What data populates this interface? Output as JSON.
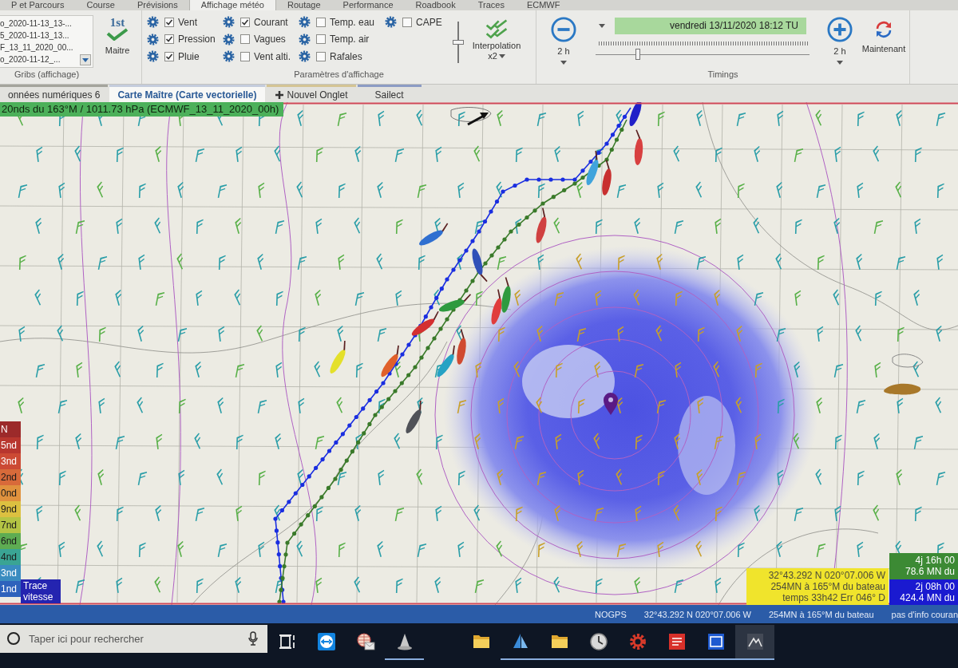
{
  "menu_tabs": [
    {
      "label": "P et Parcours",
      "selected": false
    },
    {
      "label": "Course",
      "selected": false
    },
    {
      "label": "Prévisions",
      "selected": false
    },
    {
      "label": "Affichage météo",
      "selected": true
    },
    {
      "label": "Routage",
      "selected": false
    },
    {
      "label": "Performance",
      "selected": false
    },
    {
      "label": "Roadbook",
      "selected": false
    },
    {
      "label": "Traces",
      "selected": false
    },
    {
      "label": "ECMWF",
      "selected": false
    }
  ],
  "ribbon": {
    "gribs": {
      "files": [
        "o_2020-11-13_13-...",
        "5_2020-11-13_13...",
        "F_13_11_2020_00...",
        "o_2020-11-12_..."
      ],
      "master": {
        "rank": "1st",
        "label": "Maitre"
      },
      "group_label": "Gribs (affichage)"
    },
    "display": {
      "layers": [
        {
          "label": "Vent",
          "checked": true
        },
        {
          "label": "Pression",
          "checked": true
        },
        {
          "label": "Pluie",
          "checked": true
        },
        {
          "label": "Courant",
          "checked": true
        },
        {
          "label": "Vagues",
          "checked": false
        },
        {
          "label": "Vent alti.",
          "checked": false
        },
        {
          "label": "Temp. eau",
          "checked": false
        },
        {
          "label": "Temp. air",
          "checked": false
        },
        {
          "label": "Rafales",
          "checked": false
        },
        {
          "label": "CAPE",
          "checked": false
        }
      ],
      "slider": {
        "level": 0.5
      },
      "interpolation": {
        "label": "Interpolation",
        "factor": "x2"
      },
      "group_label": "Paramètres d'affichage"
    },
    "timings": {
      "step_back": "2 h",
      "date": "vendredi 13/11/2020 18:12 TU",
      "slider": {
        "level": 0.19
      },
      "step_forward": "2 h",
      "now": "Maintenant",
      "group_label": "Timings"
    }
  },
  "doc_tabs": [
    {
      "kind": "tab",
      "label": "onnées numériques 6",
      "selected": false,
      "color": "#a4a49c"
    },
    {
      "kind": "tab",
      "label": "Carte Maître (Carte vectorielle)",
      "selected": true,
      "color": "#c4ccdc"
    },
    {
      "kind": "new",
      "label": "Nouvel Onglet",
      "selected": false,
      "color": "#d4c494"
    },
    {
      "kind": "tab",
      "label": "Sailect",
      "selected": false,
      "color": "#8c9cc4"
    }
  ],
  "map": {
    "readout": "20nds du 163°M / 1011.73 hPa (ECMWF_13_11_2020_00h)",
    "legend": [
      {
        "label": "N",
        "color": "#9c2a2a"
      },
      {
        "label": "5nd",
        "color": "#b8362e"
      },
      {
        "label": "3nd",
        "color": "#cc4a34"
      },
      {
        "label": "2nd",
        "color": "#d86a3a"
      },
      {
        "label": "0nd",
        "color": "#e0923e"
      },
      {
        "label": "9nd",
        "color": "#dcc040"
      },
      {
        "label": "7nd",
        "color": "#b4c444"
      },
      {
        "label": "6nd",
        "color": "#5eac52"
      },
      {
        "label": "4nd",
        "color": "#3aa494"
      },
      {
        "label": "3nd",
        "color": "#3a8cc0"
      },
      {
        "label": "1nd",
        "color": "#2e62bc"
      }
    ],
    "trace_label": "Trace vitesse",
    "cursor_info": [
      "32°43.292 N 020°07.006 W",
      "254MN à 165°M du bateau",
      "temps 33h42 Err 046° D"
    ],
    "eta": [
      {
        "lines": [
          "4j 16h 00",
          "78.6 MN du"
        ],
        "color": "#3c8a34"
      },
      {
        "lines": [
          "2j 08h 00",
          "424.4 MN du"
        ],
        "color": "#1a1ad0"
      }
    ]
  },
  "status_bar": [
    "NOGPS",
    "32°43.292 N 020°07.006 W",
    "254MN à 165°M du bateau",
    "pas d'info couran"
  ],
  "taskbar": {
    "search": {
      "placeholder": "Taper ici pour rechercher"
    },
    "apps": [
      {
        "kind": "task-view",
        "running": false,
        "selected": false
      },
      {
        "kind": "remote",
        "running": false,
        "selected": false
      },
      {
        "kind": "globe-mail",
        "running": false,
        "selected": false
      },
      {
        "kind": "cone",
        "running": true,
        "selected": false
      },
      {
        "kind": "folder",
        "running": false,
        "selected": false
      },
      {
        "kind": "sail",
        "running": true,
        "selected": false
      },
      {
        "kind": "folder",
        "running": true,
        "selected": false
      },
      {
        "kind": "clock",
        "running": true,
        "selected": false
      },
      {
        "kind": "gear",
        "running": true,
        "selected": false
      },
      {
        "kind": "document",
        "running": true,
        "selected": false
      },
      {
        "kind": "window",
        "running": true,
        "selected": false
      },
      {
        "kind": "chart",
        "running": true,
        "selected": true
      }
    ]
  }
}
